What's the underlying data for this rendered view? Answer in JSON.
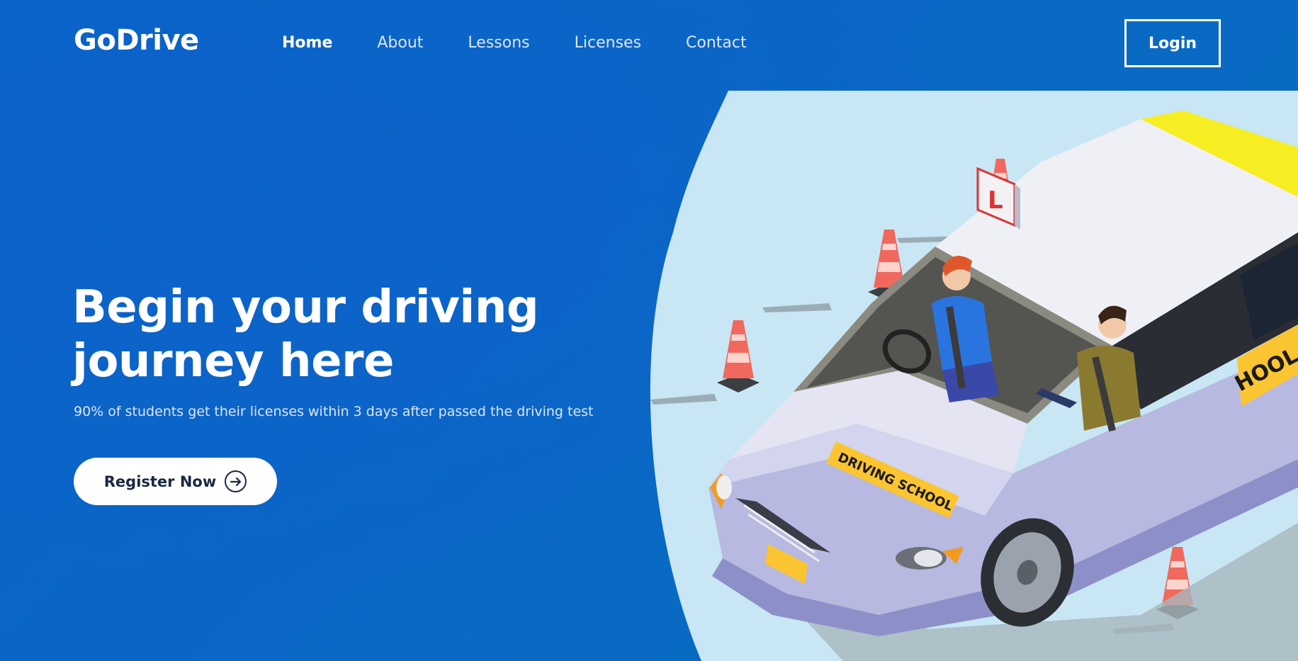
{
  "brand": {
    "name": "GoDrive"
  },
  "nav": {
    "items": [
      {
        "label": "Home",
        "active": true
      },
      {
        "label": "About",
        "active": false
      },
      {
        "label": "Lessons",
        "active": false
      },
      {
        "label": "Licenses",
        "active": false
      },
      {
        "label": "Contact",
        "active": false
      }
    ],
    "login_label": "Login"
  },
  "hero": {
    "title_line1": "Begin your driving",
    "title_line2": "journey here",
    "subtitle": "90% of students get their licenses within 3 days after passed the driving test",
    "cta_label": "Register Now"
  },
  "illustration": {
    "hood_sign": "DRIVING SCHOOL",
    "side_sign": "HOOL",
    "roof_sign": "L"
  },
  "colors": {
    "background": "#0a64c8",
    "panel": "#c8e6f3",
    "button_text": "#1a2840",
    "cone": "#f0685e",
    "sign_yellow": "#fbc531"
  },
  "icons": {
    "cta": "arrow-right-circle-icon"
  }
}
